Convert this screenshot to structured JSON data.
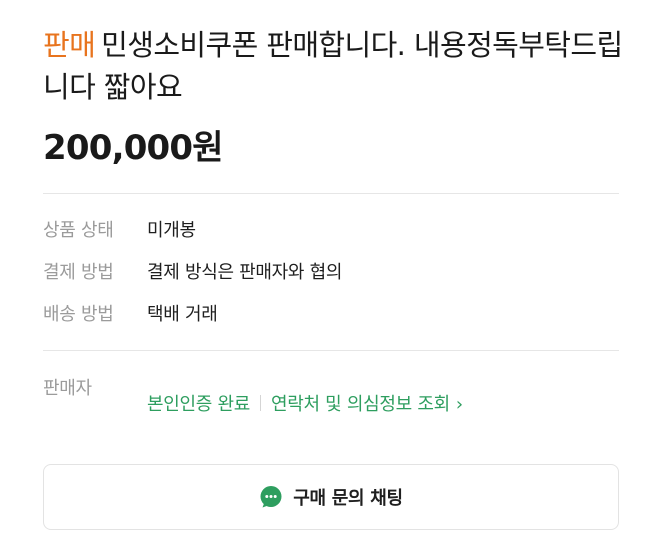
{
  "listing": {
    "tag": "판매",
    "title": "민생소비쿠폰 판매합니다. 내용정독부탁드립니다 짧아요",
    "price": "200,000원"
  },
  "details": [
    {
      "label": "상품 상태",
      "value": "미개봉"
    },
    {
      "label": "결제 방법",
      "value": "결제 방식은 판매자와 협의"
    },
    {
      "label": "배송 방법",
      "value": "택배 거래"
    }
  ],
  "seller": {
    "label": "판매자",
    "verified": "본인인증 완료",
    "contact_link": "연락처 및 의심정보 조회",
    "chevron_icon": "chevron-right-icon"
  },
  "chat_button": {
    "label": "구매 문의 채팅",
    "icon": "chat-bubble-icon"
  },
  "colors": {
    "tag": "#e8741e",
    "accent_green": "#2e9e5f",
    "label_gray": "#9b9b9b"
  }
}
